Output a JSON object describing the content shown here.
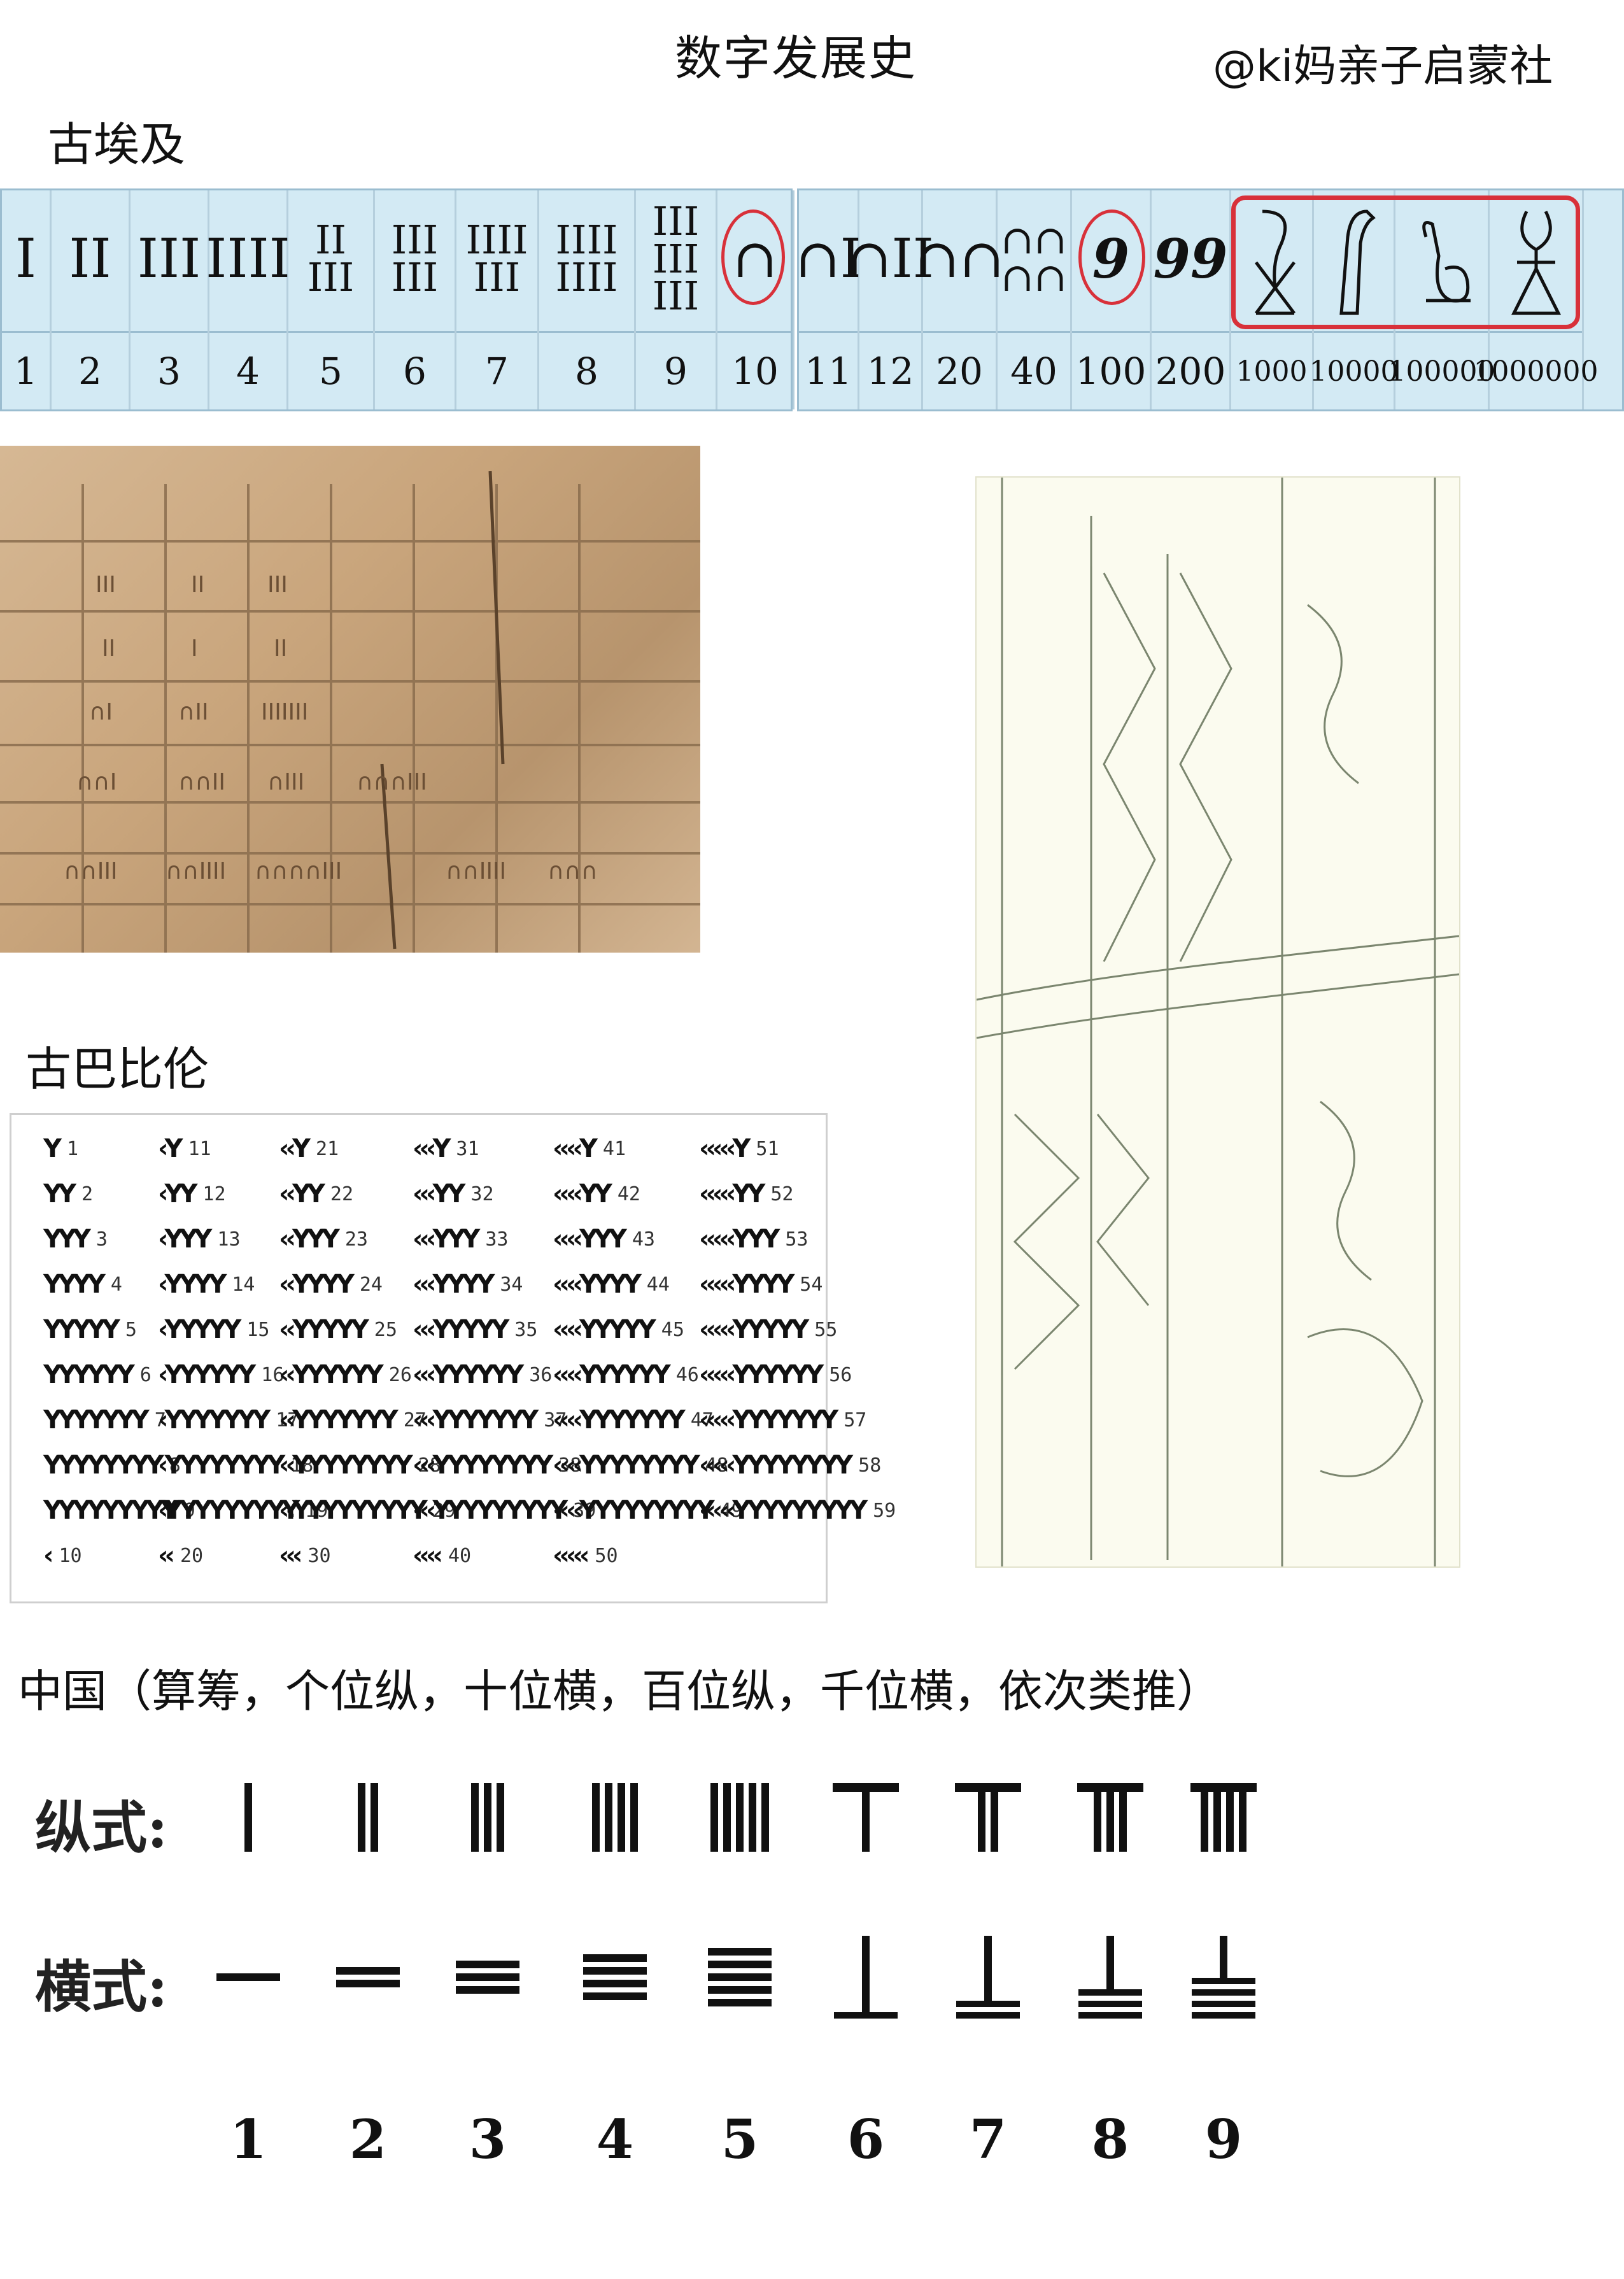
{
  "title": "数字发展史",
  "watermark": "@ki妈亲子启蒙社",
  "sections": {
    "egypt": {
      "heading": "古埃及",
      "numbers": [
        "1",
        "2",
        "3",
        "4",
        "5",
        "6",
        "7",
        "8",
        "9",
        "10",
        "11",
        "12",
        "20",
        "40",
        "100",
        "200",
        "1000",
        "10000",
        "100000",
        "1000000"
      ]
    },
    "babylon": {
      "heading": "古巴比伦",
      "cells": [
        "1",
        "11",
        "21",
        "31",
        "41",
        "51",
        "2",
        "12",
        "22",
        "32",
        "42",
        "52",
        "3",
        "13",
        "23",
        "33",
        "43",
        "53",
        "4",
        "14",
        "24",
        "34",
        "44",
        "54",
        "5",
        "15",
        "25",
        "35",
        "45",
        "55",
        "6",
        "16",
        "26",
        "36",
        "46",
        "56",
        "7",
        "17",
        "27",
        "37",
        "47",
        "57",
        "8",
        "18",
        "28",
        "38",
        "48",
        "58",
        "9",
        "19",
        "29",
        "39",
        "49",
        "59",
        "10",
        "20",
        "30",
        "40",
        "50"
      ]
    },
    "china": {
      "heading": "中国（算筹，个位纵，十位横，百位纵，千位横，依次类推）",
      "vertical_label": "纵式:",
      "horizontal_label": "横式:",
      "numbers": [
        "1",
        "2",
        "3",
        "4",
        "5",
        "6",
        "7",
        "8",
        "9"
      ]
    }
  },
  "colors": {
    "table_bg": "#d3eaf4",
    "highlight": "#d8313a"
  }
}
